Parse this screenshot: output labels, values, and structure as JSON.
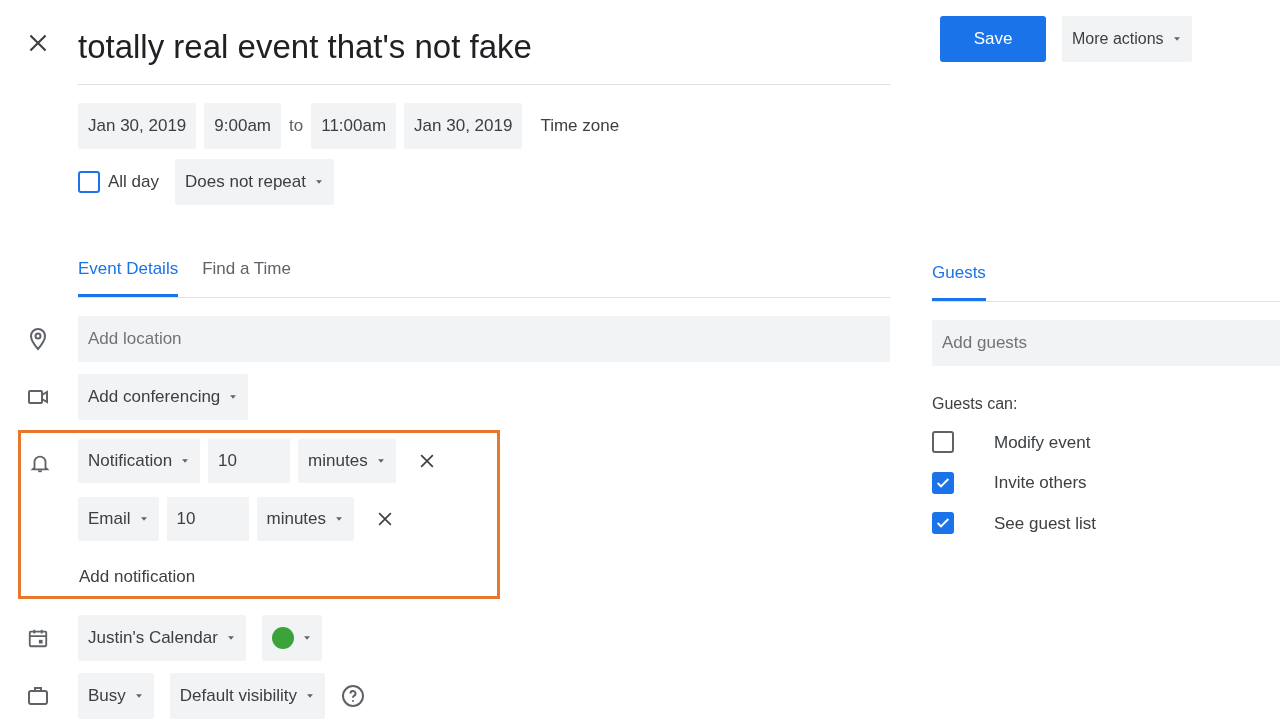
{
  "title": "totally real event that's not fake",
  "actions": [
    {
      "label": "Save",
      "kind": "primary"
    },
    {
      "label": "More actions",
      "kind": "menu"
    }
  ],
  "datetime": [
    {
      "label": "Jan 30, 2019",
      "kind": "chip"
    },
    {
      "label": "9:00am",
      "kind": "chip"
    },
    {
      "label": "to",
      "kind": "text"
    },
    {
      "label": "11:00am",
      "kind": "chip"
    },
    {
      "label": "Jan 30, 2019",
      "kind": "chip"
    },
    {
      "label": "Time zone",
      "kind": "link"
    }
  ],
  "all_day": {
    "label": "All day",
    "checked": false
  },
  "repeat": "Does not repeat",
  "tabs": [
    {
      "label": "Event Details",
      "selected": true
    },
    {
      "label": "Find a Time",
      "selected": false
    }
  ],
  "location": {
    "placeholder": "Add location"
  },
  "conferencing": "Add conferencing",
  "notifications": {
    "highlighted": true,
    "items": [
      {
        "type": "Notification",
        "amount": "10",
        "unit": "minutes"
      },
      {
        "type": "Email",
        "amount": "10",
        "unit": "minutes"
      }
    ],
    "add": "Add notification"
  },
  "calendar": {
    "name": "Justin's Calendar",
    "color": "#3ba33a"
  },
  "availability": "Busy",
  "visibility": "Default visibility",
  "guests": {
    "tab": {
      "label": "Guests",
      "selected": true
    },
    "placeholder": "Add guests",
    "permissions_title": "Guests can:",
    "permissions": [
      {
        "label": "Modify event",
        "checked": false
      },
      {
        "label": "Invite others",
        "checked": true
      },
      {
        "label": "See guest list",
        "checked": true
      }
    ]
  }
}
